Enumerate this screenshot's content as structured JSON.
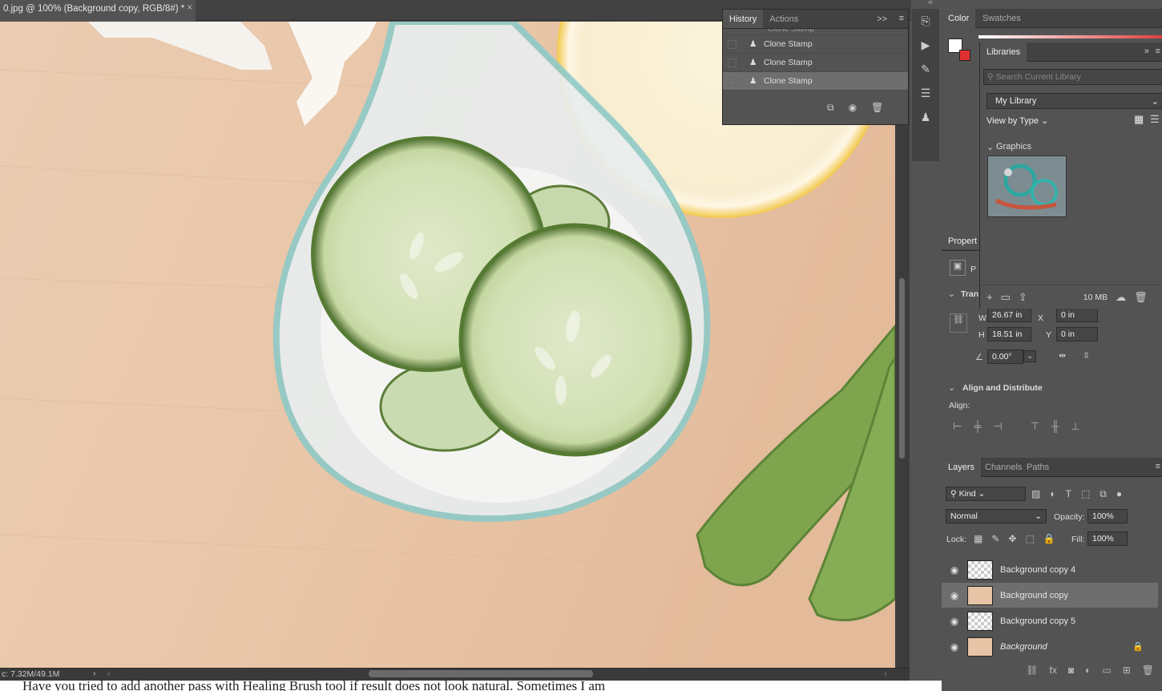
{
  "document": {
    "tab_title": "0.jpg @ 100% (Background copy, RGB/8#) *",
    "close_glyph": "×",
    "status": "c: 7.32M/49.1M"
  },
  "footnote": "Have you tried to add another pass with Healing Brush tool if result does not look natural. Sometimes I am",
  "history": {
    "tabs": [
      "History",
      "Actions"
    ],
    "items": [
      "Clone Stamp",
      "Clone Stamp",
      "Clone Stamp",
      "Clone Stamp"
    ],
    "partial_item": "Clone Stamp",
    "collapse_glyph": ">>"
  },
  "color_panel": {
    "tabs": [
      "Color",
      "Swatches"
    ]
  },
  "libraries": {
    "title": "Libraries",
    "search_placeholder": "Search Current Library",
    "library_select": "My Library",
    "view_by": "View by Type",
    "section": "Graphics",
    "size": "10 MB"
  },
  "properties": {
    "title_partial": "Propert",
    "pixel_label_partial": "P",
    "transform_partial": "Tran",
    "w": "26.67 in",
    "x": "0 in",
    "h": "18.51 in",
    "y": "0 in",
    "w_label": "W",
    "x_label": "X",
    "h_label": "H",
    "y_label": "Y",
    "angle": "0.00°",
    "align_section": "Align and Distribute",
    "align_label": "Align:"
  },
  "layers_panel": {
    "tabs": [
      "Layers",
      "Channels",
      "Paths"
    ],
    "kind": "Kind",
    "blend_mode": "Normal",
    "opacity_label": "Opacity:",
    "opacity": "100%",
    "lock_label": "Lock:",
    "fill_label": "Fill:",
    "fill": "100%",
    "layers": [
      {
        "name": "Background copy 4",
        "selected": false,
        "thumb": "checker"
      },
      {
        "name": "Background copy",
        "selected": true,
        "thumb": "image"
      },
      {
        "name": "Background copy 5",
        "selected": false,
        "thumb": "checker"
      },
      {
        "name": "Background",
        "selected": false,
        "thumb": "image",
        "italic": true,
        "locked": true
      }
    ]
  }
}
